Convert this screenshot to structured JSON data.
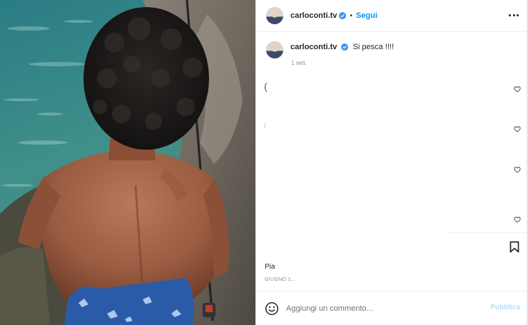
{
  "post": {
    "username": "carloconti.tv",
    "dot": "•",
    "follow_label": "Segui",
    "more_icon": "more-horizontal-icon",
    "caption": "Si pesca !!!!",
    "time_ago": "1 sett.",
    "ghost_text_1": "(",
    "ghost_text_2": "/",
    "likes_text": "Pia",
    "date_text": "GIUGNO 1..."
  },
  "comment": {
    "placeholder": "Aggiungi un commento...",
    "publish_label": "Pubblica"
  },
  "colors": {
    "follow": "#0095f6",
    "publish_disabled": "#b2dffc",
    "verified": "#3897f0",
    "muted": "#8e8e8e"
  },
  "icons": [
    "verified-badge-icon",
    "heart-icon",
    "bookmark-icon",
    "emoji-icon"
  ]
}
